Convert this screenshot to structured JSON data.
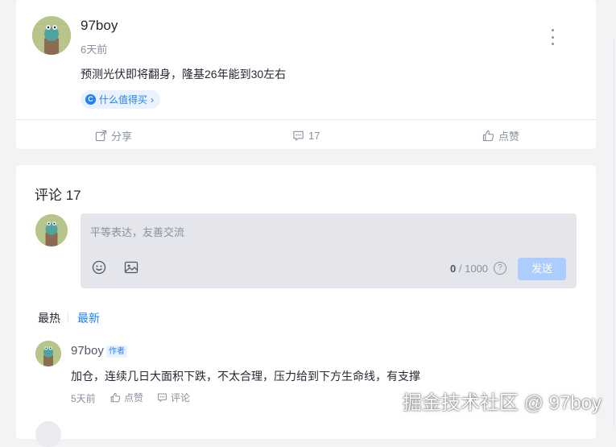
{
  "post": {
    "author": "97boy",
    "time": "6天前",
    "content": "预测光伏即将翻身，隆基26年能到30左右",
    "topic": "什么值得买",
    "actions": {
      "share": "分享",
      "comments": "17",
      "like": "点赞"
    }
  },
  "comments_section": {
    "title": "评论 17",
    "editor": {
      "placeholder": "平等表达，友善交流",
      "counter_current": "0",
      "counter_max": "/ 1000",
      "send": "发送"
    },
    "sort": {
      "hot": "最热",
      "new": "最新"
    },
    "items": [
      {
        "author": "97boy",
        "badge": "作者",
        "text": "加仓，连续几日大面积下跌，不太合理，压力给到下方生命线，有支撑",
        "time": "5天前",
        "like": "点赞",
        "reply": "评论"
      }
    ]
  },
  "watermark": "掘金技术社区 @ 97boy",
  "colors": {
    "accent": "#1e80ff",
    "page_bg": "#f2f3f5",
    "send_disabled": "#abcdff",
    "muted_text": "#8a919f"
  },
  "icons": [
    "more-icon",
    "share-icon",
    "comment-icon",
    "like-icon",
    "emoji-icon",
    "image-icon",
    "help-icon",
    "topic-icon"
  ]
}
